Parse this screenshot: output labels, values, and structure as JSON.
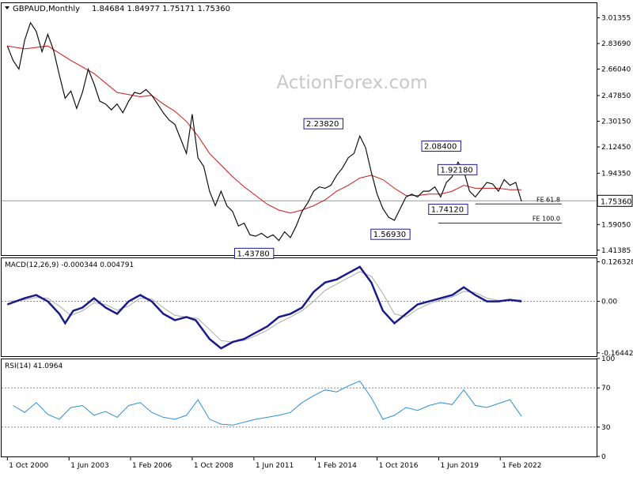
{
  "chart_data": {
    "type": "line",
    "symbol": "GBPAUD,Monthly",
    "ohlc_text": "1.84684 1.84977 1.75171 1.75360",
    "watermark": "ActionForex.com",
    "price_panel": {
      "ylim": [
        1.38,
        3.12
      ],
      "y_ticks": [
        3.01355,
        2.8369,
        2.6604,
        2.4785,
        2.3015,
        2.1245,
        1.9435,
        1.7665,
        1.5905,
        1.41385
      ],
      "y_tick_labels": [
        "3.01355",
        "2.83690",
        "2.66040",
        "2.47850",
        "2.30150",
        "2.12450",
        "1.94350",
        "1.76650",
        "1.59050",
        "1.41385"
      ],
      "current_price": 1.7536,
      "current_price_label": "1.75360",
      "colors": {
        "price": "#111111",
        "ma": "#d01818",
        "reference": "#888888"
      },
      "price_close": [
        [
          2000.75,
          2.82
        ],
        [
          2001.0,
          2.72
        ],
        [
          2001.25,
          2.66
        ],
        [
          2001.5,
          2.86
        ],
        [
          2001.75,
          2.98
        ],
        [
          2002.0,
          2.92
        ],
        [
          2002.25,
          2.78
        ],
        [
          2002.5,
          2.9
        ],
        [
          2002.75,
          2.79
        ],
        [
          2003.0,
          2.62
        ],
        [
          2003.25,
          2.46
        ],
        [
          2003.5,
          2.51
        ],
        [
          2003.75,
          2.39
        ],
        [
          2004.0,
          2.5
        ],
        [
          2004.25,
          2.66
        ],
        [
          2004.5,
          2.56
        ],
        [
          2004.75,
          2.44
        ],
        [
          2005.0,
          2.42
        ],
        [
          2005.25,
          2.38
        ],
        [
          2005.5,
          2.42
        ],
        [
          2005.75,
          2.36
        ],
        [
          2006.0,
          2.44
        ],
        [
          2006.25,
          2.5
        ],
        [
          2006.5,
          2.49
        ],
        [
          2006.75,
          2.52
        ],
        [
          2007.0,
          2.48
        ],
        [
          2007.25,
          2.42
        ],
        [
          2007.5,
          2.36
        ],
        [
          2007.75,
          2.31
        ],
        [
          2008.0,
          2.28
        ],
        [
          2008.25,
          2.18
        ],
        [
          2008.5,
          2.08
        ],
        [
          2008.75,
          2.35
        ],
        [
          2009.0,
          2.05
        ],
        [
          2009.25,
          1.99
        ],
        [
          2009.5,
          1.82
        ],
        [
          2009.75,
          1.72
        ],
        [
          2010.0,
          1.82
        ],
        [
          2010.25,
          1.72
        ],
        [
          2010.5,
          1.68
        ],
        [
          2010.75,
          1.58
        ],
        [
          2011.0,
          1.6
        ],
        [
          2011.25,
          1.52
        ],
        [
          2011.5,
          1.51
        ],
        [
          2011.75,
          1.53
        ],
        [
          2012.0,
          1.5
        ],
        [
          2012.25,
          1.52
        ],
        [
          2012.5,
          1.48
        ],
        [
          2012.75,
          1.54
        ],
        [
          2013.0,
          1.5
        ],
        [
          2013.25,
          1.58
        ],
        [
          2013.5,
          1.68
        ],
        [
          2013.75,
          1.74
        ],
        [
          2014.0,
          1.82
        ],
        [
          2014.25,
          1.85
        ],
        [
          2014.5,
          1.84
        ],
        [
          2014.75,
          1.86
        ],
        [
          2015.0,
          1.93
        ],
        [
          2015.25,
          1.98
        ],
        [
          2015.5,
          2.05
        ],
        [
          2015.75,
          2.08
        ],
        [
          2016.0,
          2.2
        ],
        [
          2016.25,
          2.12
        ],
        [
          2016.5,
          1.95
        ],
        [
          2016.75,
          1.8
        ],
        [
          2017.0,
          1.7
        ],
        [
          2017.25,
          1.64
        ],
        [
          2017.5,
          1.62
        ],
        [
          2017.75,
          1.7
        ],
        [
          2018.0,
          1.78
        ],
        [
          2018.25,
          1.8
        ],
        [
          2018.5,
          1.78
        ],
        [
          2018.75,
          1.82
        ],
        [
          2019.0,
          1.82
        ],
        [
          2019.25,
          1.85
        ],
        [
          2019.5,
          1.78
        ],
        [
          2019.75,
          1.88
        ],
        [
          2020.0,
          1.92
        ],
        [
          2020.25,
          2.02
        ],
        [
          2020.5,
          1.96
        ],
        [
          2020.75,
          1.82
        ],
        [
          2021.0,
          1.78
        ],
        [
          2021.25,
          1.83
        ],
        [
          2021.5,
          1.88
        ],
        [
          2021.75,
          1.87
        ],
        [
          2022.0,
          1.82
        ],
        [
          2022.25,
          1.9
        ],
        [
          2022.5,
          1.86
        ],
        [
          2022.75,
          1.88
        ],
        [
          2023.0,
          1.75
        ]
      ],
      "moving_average": [
        [
          2000.75,
          2.82
        ],
        [
          2001.5,
          2.8
        ],
        [
          2002.5,
          2.82
        ],
        [
          2003.5,
          2.72
        ],
        [
          2004.5,
          2.63
        ],
        [
          2005.5,
          2.5
        ],
        [
          2006.5,
          2.47
        ],
        [
          2007.0,
          2.48
        ],
        [
          2007.5,
          2.42
        ],
        [
          2008.0,
          2.37
        ],
        [
          2008.5,
          2.3
        ],
        [
          2009.0,
          2.2
        ],
        [
          2009.5,
          2.08
        ],
        [
          2010.0,
          2.0
        ],
        [
          2010.5,
          1.92
        ],
        [
          2011.0,
          1.85
        ],
        [
          2011.5,
          1.79
        ],
        [
          2012.0,
          1.73
        ],
        [
          2012.5,
          1.69
        ],
        [
          2013.0,
          1.67
        ],
        [
          2013.5,
          1.69
        ],
        [
          2014.0,
          1.72
        ],
        [
          2014.5,
          1.76
        ],
        [
          2015.0,
          1.82
        ],
        [
          2015.5,
          1.86
        ],
        [
          2016.0,
          1.91
        ],
        [
          2016.5,
          1.93
        ],
        [
          2017.0,
          1.9
        ],
        [
          2017.5,
          1.84
        ],
        [
          2018.0,
          1.79
        ],
        [
          2018.5,
          1.79
        ],
        [
          2019.0,
          1.8
        ],
        [
          2019.5,
          1.8
        ],
        [
          2020.0,
          1.82
        ],
        [
          2020.5,
          1.86
        ],
        [
          2021.0,
          1.84
        ],
        [
          2021.5,
          1.84
        ],
        [
          2022.0,
          1.84
        ],
        [
          2022.5,
          1.83
        ],
        [
          2023.0,
          1.83
        ]
      ],
      "callouts": [
        {
          "x": 2012.0,
          "y": 1.4378,
          "text": "1.43780",
          "place": "below"
        },
        {
          "x": 2015.0,
          "y": 2.2382,
          "text": "2.23820",
          "place": "above"
        },
        {
          "x": 2017.9,
          "y": 1.5693,
          "text": "1.56930",
          "place": "below"
        },
        {
          "x": 2020.1,
          "y": 2.084,
          "text": "2.08400",
          "place": "above"
        },
        {
          "x": 2020.8,
          "y": 1.9218,
          "text": "1.92180",
          "place": "above"
        },
        {
          "x": 2020.4,
          "y": 1.7412,
          "text": "1.74120",
          "place": "below"
        }
      ],
      "reference_lines": [
        {
          "label": "FE 61.8",
          "y": 1.732,
          "x_start": 2021.0
        },
        {
          "label": "FE 100.0",
          "y": 1.6,
          "x_start": 2019.4
        }
      ]
    },
    "macd_panel": {
      "title": "MACD(12,26,9) -0.000344 0.004791",
      "ylim": [
        -0.175,
        0.14
      ],
      "y_ticks": [
        0.126328,
        0.0,
        -0.164422
      ],
      "y_tick_labels": [
        "0.126328",
        "0.00",
        "-0.164422"
      ],
      "colors": {
        "macd": "#1a1a8c",
        "signal": "#aaaaaa",
        "zero": "#888888"
      },
      "macd": [
        [
          2000.75,
          -0.01
        ],
        [
          2001.5,
          0.01
        ],
        [
          2002.0,
          0.02
        ],
        [
          2002.5,
          0.0
        ],
        [
          2003.0,
          -0.04
        ],
        [
          2003.25,
          -0.07
        ],
        [
          2003.6,
          -0.03
        ],
        [
          2004.0,
          -0.02
        ],
        [
          2004.5,
          0.01
        ],
        [
          2005.0,
          -0.02
        ],
        [
          2005.5,
          -0.04
        ],
        [
          2006.0,
          0.0
        ],
        [
          2006.5,
          0.02
        ],
        [
          2007.0,
          0.0
        ],
        [
          2007.5,
          -0.04
        ],
        [
          2008.0,
          -0.06
        ],
        [
          2008.5,
          -0.05
        ],
        [
          2008.9,
          -0.06
        ],
        [
          2009.5,
          -0.12
        ],
        [
          2010.0,
          -0.15
        ],
        [
          2010.5,
          -0.13
        ],
        [
          2011.0,
          -0.12
        ],
        [
          2011.5,
          -0.1
        ],
        [
          2012.0,
          -0.08
        ],
        [
          2012.5,
          -0.05
        ],
        [
          2013.0,
          -0.04
        ],
        [
          2013.5,
          -0.02
        ],
        [
          2014.0,
          0.03
        ],
        [
          2014.5,
          0.06
        ],
        [
          2015.0,
          0.07
        ],
        [
          2015.5,
          0.09
        ],
        [
          2016.0,
          0.11
        ],
        [
          2016.5,
          0.06
        ],
        [
          2017.0,
          -0.03
        ],
        [
          2017.5,
          -0.07
        ],
        [
          2018.0,
          -0.04
        ],
        [
          2018.5,
          -0.01
        ],
        [
          2019.0,
          0.0
        ],
        [
          2019.5,
          0.01
        ],
        [
          2020.0,
          0.02
        ],
        [
          2020.5,
          0.045
        ],
        [
          2021.0,
          0.02
        ],
        [
          2021.5,
          0.0
        ],
        [
          2022.0,
          0.0
        ],
        [
          2022.5,
          0.005
        ],
        [
          2023.0,
          0.0
        ]
      ],
      "signal": [
        [
          2000.75,
          0.0
        ],
        [
          2001.5,
          0.005
        ],
        [
          2002.0,
          0.012
        ],
        [
          2002.5,
          0.01
        ],
        [
          2003.0,
          -0.015
        ],
        [
          2003.5,
          -0.045
        ],
        [
          2004.0,
          -0.03
        ],
        [
          2004.5,
          -0.005
        ],
        [
          2005.0,
          -0.01
        ],
        [
          2005.5,
          -0.028
        ],
        [
          2006.0,
          -0.015
        ],
        [
          2006.5,
          0.01
        ],
        [
          2007.0,
          0.008
        ],
        [
          2007.5,
          -0.02
        ],
        [
          2008.0,
          -0.045
        ],
        [
          2008.5,
          -0.05
        ],
        [
          2009.0,
          -0.055
        ],
        [
          2009.5,
          -0.09
        ],
        [
          2010.0,
          -0.125
        ],
        [
          2010.5,
          -0.13
        ],
        [
          2011.0,
          -0.125
        ],
        [
          2011.5,
          -0.11
        ],
        [
          2012.0,
          -0.092
        ],
        [
          2012.5,
          -0.068
        ],
        [
          2013.0,
          -0.05
        ],
        [
          2013.5,
          -0.03
        ],
        [
          2014.0,
          0.0
        ],
        [
          2014.5,
          0.035
        ],
        [
          2015.0,
          0.055
        ],
        [
          2015.5,
          0.075
        ],
        [
          2016.0,
          0.095
        ],
        [
          2016.5,
          0.08
        ],
        [
          2017.0,
          0.025
        ],
        [
          2017.5,
          -0.04
        ],
        [
          2018.0,
          -0.05
        ],
        [
          2018.5,
          -0.025
        ],
        [
          2019.0,
          -0.008
        ],
        [
          2019.5,
          0.004
        ],
        [
          2020.0,
          0.014
        ],
        [
          2020.5,
          0.032
        ],
        [
          2021.0,
          0.028
        ],
        [
          2021.5,
          0.01
        ],
        [
          2022.0,
          0.003
        ],
        [
          2022.5,
          0.004
        ],
        [
          2023.0,
          0.0048
        ]
      ]
    },
    "rsi_panel": {
      "title": "RSI(14) 41.0964",
      "ylim": [
        0,
        100
      ],
      "y_ticks": [
        100,
        70,
        30,
        0
      ],
      "y_tick_labels": [
        "100",
        "70",
        "30",
        "0"
      ],
      "levels": [
        70,
        30
      ],
      "colors": {
        "rsi": "#2b8fd6",
        "level": "#888888"
      },
      "rsi": [
        [
          2001.0,
          52
        ],
        [
          2001.5,
          45
        ],
        [
          2002.0,
          55
        ],
        [
          2002.5,
          43
        ],
        [
          2003.0,
          38
        ],
        [
          2003.5,
          50
        ],
        [
          2004.0,
          52
        ],
        [
          2004.5,
          42
        ],
        [
          2005.0,
          46
        ],
        [
          2005.5,
          40
        ],
        [
          2006.0,
          52
        ],
        [
          2006.5,
          55
        ],
        [
          2007.0,
          45
        ],
        [
          2007.5,
          40
        ],
        [
          2008.0,
          38
        ],
        [
          2008.5,
          42
        ],
        [
          2009.0,
          58
        ],
        [
          2009.5,
          38
        ],
        [
          2010.0,
          33
        ],
        [
          2010.5,
          32
        ],
        [
          2011.0,
          35
        ],
        [
          2011.5,
          38
        ],
        [
          2012.0,
          40
        ],
        [
          2012.5,
          42
        ],
        [
          2013.0,
          45
        ],
        [
          2013.5,
          55
        ],
        [
          2014.0,
          62
        ],
        [
          2014.5,
          68
        ],
        [
          2015.0,
          66
        ],
        [
          2015.5,
          72
        ],
        [
          2016.0,
          77
        ],
        [
          2016.5,
          60
        ],
        [
          2017.0,
          38
        ],
        [
          2017.5,
          42
        ],
        [
          2018.0,
          50
        ],
        [
          2018.5,
          47
        ],
        [
          2019.0,
          52
        ],
        [
          2019.5,
          55
        ],
        [
          2020.0,
          53
        ],
        [
          2020.5,
          68
        ],
        [
          2021.0,
          52
        ],
        [
          2021.5,
          50
        ],
        [
          2022.0,
          54
        ],
        [
          2022.5,
          58
        ],
        [
          2023.0,
          41
        ]
      ]
    },
    "x_axis": {
      "xlim": [
        2000.5,
        2026.25
      ],
      "ticks": [
        {
          "x": 2000.75,
          "label": "1 Oct 2000"
        },
        {
          "x": 2003.42,
          "label": "1 Jun 2003"
        },
        {
          "x": 2006.08,
          "label": "1 Feb 2006"
        },
        {
          "x": 2008.75,
          "label": "1 Oct 2008"
        },
        {
          "x": 2011.42,
          "label": "1 Jun 2011"
        },
        {
          "x": 2014.08,
          "label": "1 Feb 2014"
        },
        {
          "x": 2016.75,
          "label": "1 Oct 2016"
        },
        {
          "x": 2019.42,
          "label": "1 Jun 2019"
        },
        {
          "x": 2022.08,
          "label": "1 Feb 2022"
        }
      ]
    }
  }
}
